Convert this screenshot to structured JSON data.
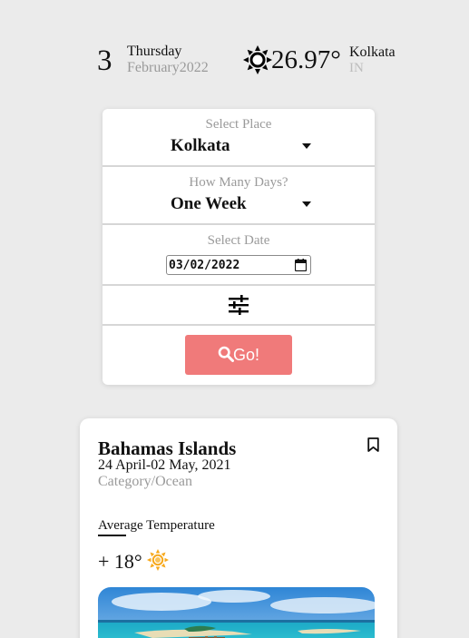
{
  "header": {
    "day": "3",
    "weekday": "Thursday",
    "month_year": "February2022",
    "temperature": "26.97°",
    "weather_icon": "sun-icon",
    "city": "Kolkata",
    "country": "IN"
  },
  "search": {
    "place_label": "Select Place",
    "place_value": "Kolkata",
    "days_label": "How Many Days?",
    "days_value": "One Week",
    "date_label": "Select Date",
    "date_value": "03/02/2022",
    "filter_icon": "sliders-icon",
    "go_label": "Go!",
    "go_color": "#f07a7a"
  },
  "destination": {
    "title": "Bahamas Islands",
    "dates": "24 April-02 May, 2021",
    "category": "Category/Ocean",
    "avg_label": "Average Temperature",
    "avg_temp": "+ 18°",
    "temp_icon": "sun-icon",
    "sun_color": "#f7a81b"
  }
}
